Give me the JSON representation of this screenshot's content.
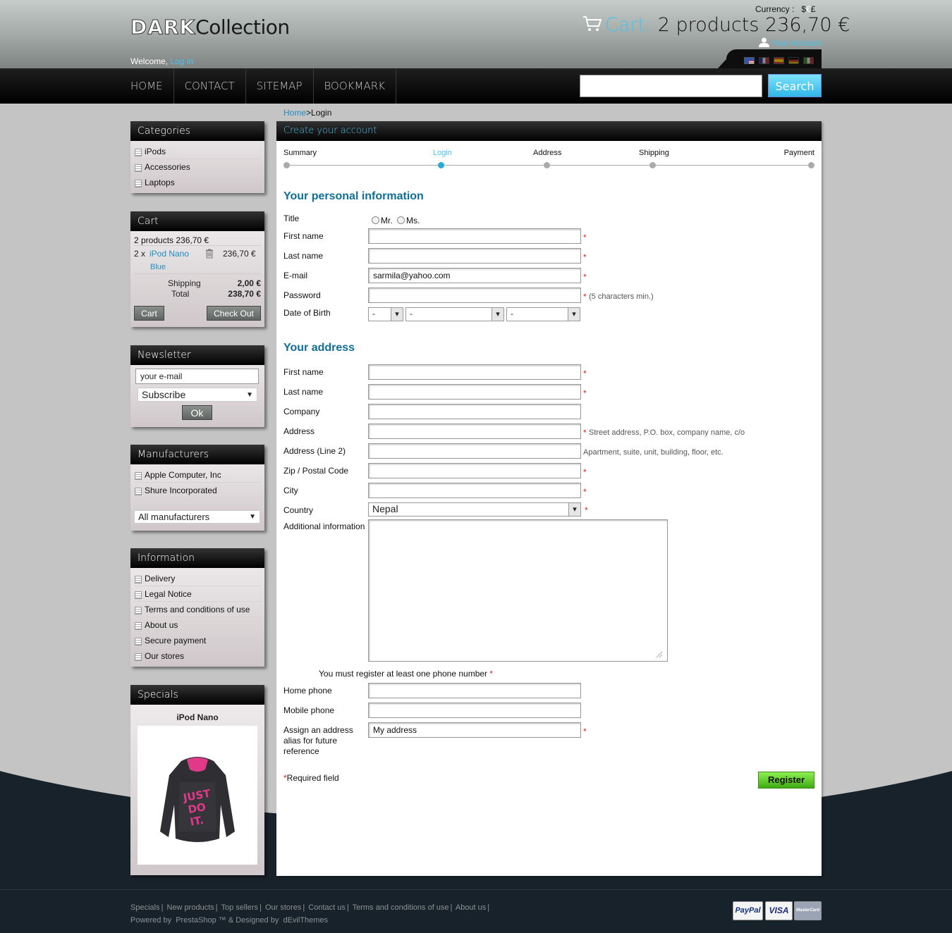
{
  "header": {
    "logo_dark": "DARK",
    "logo_collection": "Collection",
    "currency_label": "Currency :",
    "currency_dollar": "$",
    "currency_euro": "€",
    "currency_pound": "£",
    "cart_label": "Cart:",
    "cart_summary": "2 products 236,70 €",
    "account_link": "Your Account",
    "welcome_text": "Welcome,",
    "login_link": "Log in",
    "flags": [
      "us-flag-icon",
      "fr-flag-icon",
      "es-flag-icon",
      "de-flag-icon",
      "it-flag-icon"
    ]
  },
  "nav": {
    "items": [
      "HOME",
      "CONTACT",
      "SITEMAP",
      "BOOKMARK"
    ],
    "search_value": "",
    "search_button": "Search"
  },
  "breadcrumb": {
    "home": "Home",
    "sep": ">",
    "current": "Login"
  },
  "sidebar": {
    "categories": {
      "title": "Categories",
      "items": [
        "iPods",
        "Accessories",
        "Laptops"
      ]
    },
    "cart": {
      "title": "Cart",
      "summary": "2 products 236,70 €",
      "item_qty": "2 x",
      "item_name": "iPod Nano",
      "item_price": "236,70 €",
      "item_variant": "Blue",
      "shipping_label": "Shipping",
      "shipping_value": "2,00 €",
      "total_label": "Total",
      "total_value": "238,70 €",
      "cart_button": "Cart",
      "checkout_button": "Check Out"
    },
    "newsletter": {
      "title": "Newsletter",
      "email_value": "your e-mail",
      "option": "Subscribe",
      "ok_button": "Ok"
    },
    "manufacturers": {
      "title": "Manufacturers",
      "items": [
        "Apple Computer, Inc",
        "Shure Incorporated"
      ],
      "select": "All manufacturers"
    },
    "information": {
      "title": "Information",
      "items": [
        "Delivery",
        "Legal Notice",
        "Terms and conditions of use",
        "About us",
        "Secure payment",
        "Our stores"
      ]
    },
    "specials": {
      "title": "Specials",
      "product": "iPod Nano"
    }
  },
  "main": {
    "title": "Create your account",
    "steps": [
      "Summary",
      "Login",
      "Address",
      "Shipping",
      "Payment"
    ],
    "personal_heading": "Your personal information",
    "title_label": "Title",
    "mr": "Mr.",
    "ms": "Ms.",
    "first_name": "First name",
    "last_name": "Last name",
    "email_label": "E-mail",
    "email_value": "sarmila@yahoo.com",
    "password_label": "Password",
    "password_hint": "(5 characters min.)",
    "dob_label": "Date of Birth",
    "dob_day": "-",
    "dob_month": "-",
    "dob_year": "-",
    "address_heading": "Your address",
    "addr_first_name": "First name",
    "addr_last_name": "Last name",
    "company": "Company",
    "address": "Address",
    "address_hint": "Street address, P.O. box, company name, c/o",
    "address2": "Address (Line 2)",
    "address2_hint": "Apartment, suite, unit, building, floor, etc.",
    "zip": "Zip / Postal Code",
    "city": "City",
    "country": "Country",
    "country_value": "Nepal",
    "additional": "Additional information",
    "phone_notice": "You must register at least one phone number",
    "home_phone": "Home phone",
    "mobile_phone": "Mobile phone",
    "alias_label": "Assign an address alias for future reference",
    "alias_value": "My address",
    "required_note": "Required field",
    "required_star": "*",
    "register_button": "Register"
  },
  "footer": {
    "links": [
      "Specials",
      "New products",
      "Top sellers",
      "Our stores",
      "Contact us",
      "Terms and conditions of use",
      "About us"
    ],
    "separator": "|",
    "powered": "Powered by  PrestaShop ™ & Designed by  dEvilThemes",
    "payments": [
      "PayPal",
      "VISA",
      "MasterCard"
    ]
  },
  "colors": {
    "accent": "#49c3ec",
    "heading": "#0f6f96",
    "register": "#5fcf2a",
    "required": "#e0241e"
  }
}
